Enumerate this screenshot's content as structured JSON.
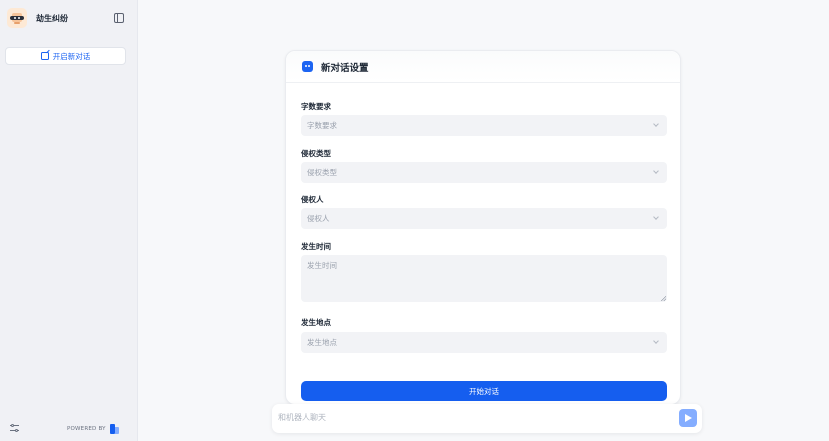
{
  "sidebar": {
    "app_name": "劫生纠纷",
    "new_chat_label": "开启新对话",
    "powered_by": "POWERED BY"
  },
  "form": {
    "title": "新对话设置",
    "fields": [
      {
        "label": "字数要求",
        "placeholder": "字数要求"
      },
      {
        "label": "侵权类型",
        "placeholder": "侵权类型"
      },
      {
        "label": "侵权人",
        "placeholder": "侵权人"
      },
      {
        "label": "发生时间",
        "placeholder": "发生时间"
      },
      {
        "label": "发生地点",
        "placeholder": "发生地点"
      }
    ],
    "start_label": "开始对话"
  },
  "chat": {
    "placeholder": "和机器人聊天"
  },
  "colors": {
    "accent": "#155eef",
    "sidebar_bg": "#f0f1f5",
    "field_bg": "#f2f3f6"
  }
}
